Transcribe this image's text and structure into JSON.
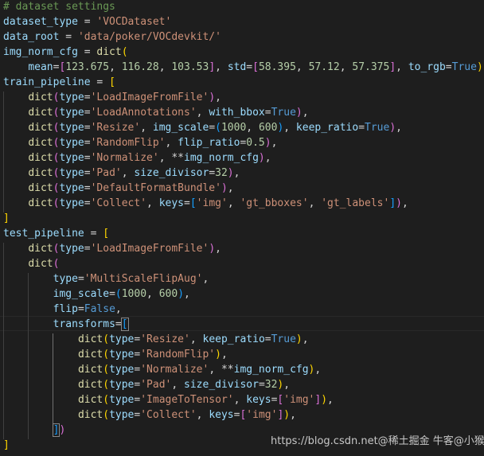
{
  "editor": {
    "code": [
      "# dataset settings",
      "dataset_type = 'VOCDataset'",
      "data_root = 'data/poker/VOCdevkit/'",
      "img_norm_cfg = dict(",
      "    mean=[123.675, 116.28, 103.53], std=[58.395, 57.12, 57.375], to_rgb=True)",
      "train_pipeline = [",
      "    dict(type='LoadImageFromFile'),",
      "    dict(type='LoadAnnotations', with_bbox=True),",
      "    dict(type='Resize', img_scale=(1000, 600), keep_ratio=True),",
      "    dict(type='RandomFlip', flip_ratio=0.5),",
      "    dict(type='Normalize', **img_norm_cfg),",
      "    dict(type='Pad', size_divisor=32),",
      "    dict(type='DefaultFormatBundle'),",
      "    dict(type='Collect', keys=['img', 'gt_bboxes', 'gt_labels']),",
      "]",
      "test_pipeline = [",
      "    dict(type='LoadImageFromFile'),",
      "    dict(",
      "        type='MultiScaleFlipAug',",
      "        img_scale=(1000, 600),",
      "        flip=False,",
      "        transforms=[",
      "            dict(type='Resize', keep_ratio=True),",
      "            dict(type='RandomFlip'),",
      "            dict(type='Normalize', **img_norm_cfg),",
      "            dict(type='Pad', size_divisor=32),",
      "            dict(type='ImageToTensor', keys=['img']),",
      "            dict(type='Collect', keys=['img']),",
      "        ])",
      "]"
    ]
  },
  "watermark": "https://blog.csdn.net@稀土掘金 牛客@小猴学IT"
}
